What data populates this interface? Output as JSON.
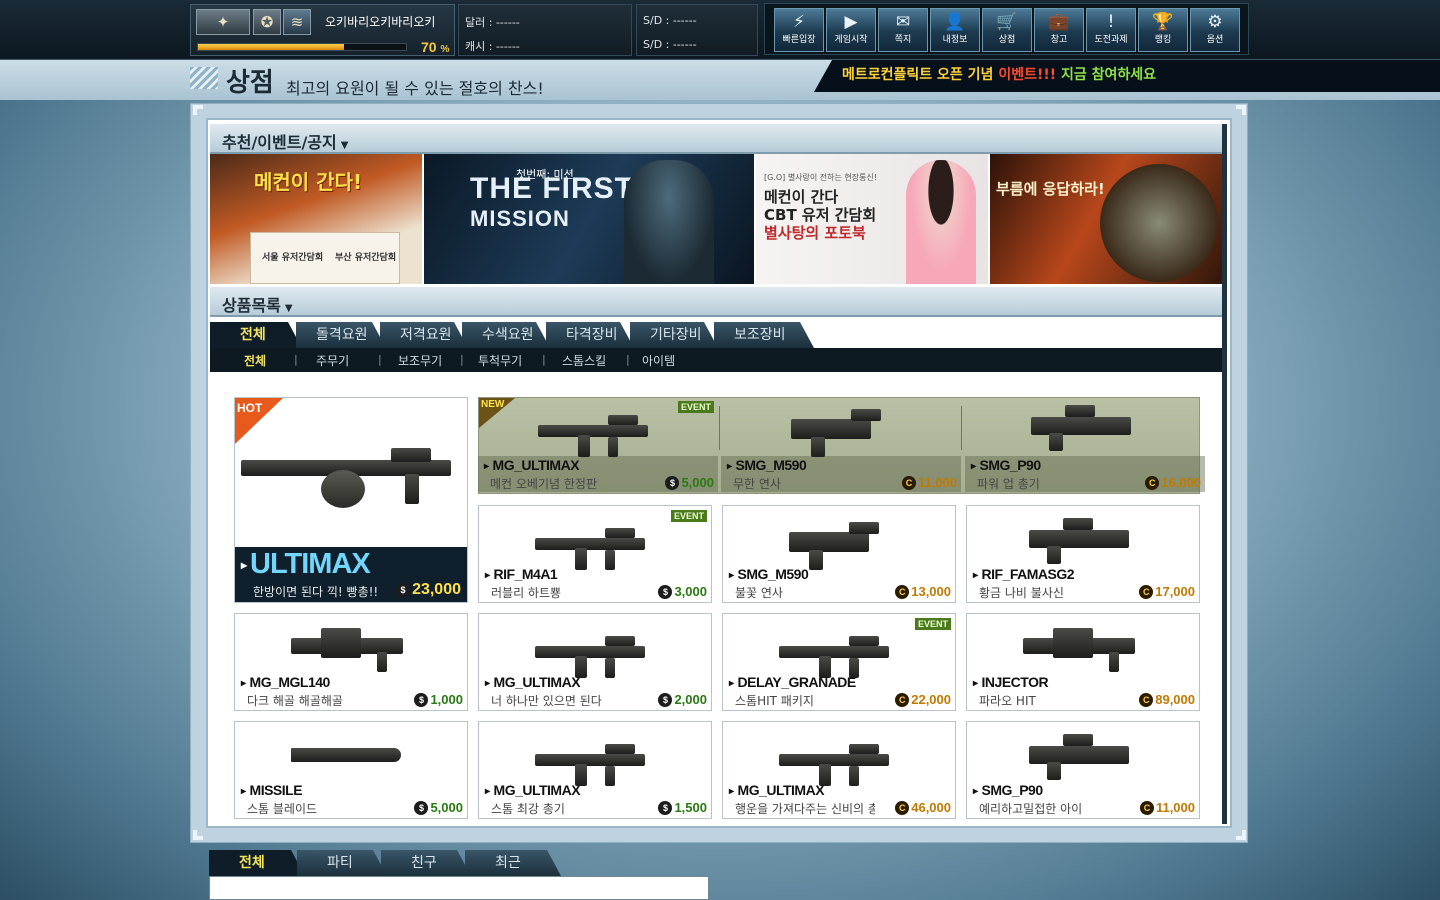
{
  "profile": {
    "nickname": "오키바리오키바리오키",
    "exp_percent": 70,
    "exp_label": "70",
    "exp_unit": "%",
    "rank_icons": [
      "eagle-rank-icon",
      "medal-icon",
      "chevron-rank-icon"
    ]
  },
  "currency": {
    "dollar": "달러 : ------",
    "cash": "캐시 : ------",
    "sd1": "S/D : ------",
    "sd2": "S/D : ------"
  },
  "menu": [
    {
      "label": "빠른입장",
      "icon": "lightning-icon",
      "glyph": "⚡"
    },
    {
      "label": "게임시작",
      "icon": "play-icon",
      "glyph": "▶"
    },
    {
      "label": "쪽지",
      "icon": "mail-icon",
      "glyph": "✉"
    },
    {
      "label": "내정보",
      "icon": "user-icon",
      "glyph": "👤"
    },
    {
      "label": "상점",
      "icon": "cart-icon",
      "glyph": "🛒"
    },
    {
      "label": "창고",
      "icon": "briefcase-icon",
      "glyph": "💼"
    },
    {
      "label": "도전과제",
      "icon": "alert-shield-icon",
      "glyph": "!"
    },
    {
      "label": "랭킹",
      "icon": "trophy-icon",
      "glyph": "🏆"
    },
    {
      "label": "옵션",
      "icon": "gear-icon",
      "glyph": "⚙"
    }
  ],
  "page": {
    "title": "상점",
    "subtitle": "최고의 요원이 될 수 있는 절호의 찬스!"
  },
  "event_banner": {
    "part1": "메트로컨플릭트 오픈 기념",
    "part2": "이벤트!!!",
    "part3": "지금 참여하세요"
  },
  "sections": {
    "recommend": "추천/이벤트/공지",
    "products": "상품목록"
  },
  "banners": {
    "b1": {
      "title": "메컨이 간다!",
      "c1": "서울 유저간담회",
      "c2": "부산 유저간담회"
    },
    "b2": {
      "sub": "첫번째: 미션",
      "line1": "THE FIRST",
      "line2": "MISSION"
    },
    "b3": {
      "small": "[G.O] 별사랑이 전하는 현장통신!",
      "l1": "메컨이 간다",
      "l2": "CBT 유저 간담회",
      "l3": "별사탕의 포토북"
    },
    "b4": {
      "title": "부름에 응답하라!"
    }
  },
  "category_tabs": [
    "전체",
    "돌격요원",
    "저격요원",
    "수색요원",
    "타격장비",
    "기타장비",
    "보조장비"
  ],
  "sub_tabs": [
    "전체",
    "주무기",
    "보조무기",
    "투척무기",
    "스톰스킬",
    "아이템"
  ],
  "hot_item": {
    "badge": "HOT",
    "name": "ULTIMAX",
    "desc": "한방이면 된다 끽! 빵총!!",
    "price": "23,000",
    "currency": "$"
  },
  "featured": [
    {
      "name": "MG_ULTIMAX",
      "desc": "메컨 오베기념 한정판",
      "price": "5,000",
      "currency": "$",
      "new": "NEW",
      "event": "EVENT"
    },
    {
      "name": "SMG_M590",
      "desc": "무한 연사",
      "price": "11,000",
      "currency": "C"
    },
    {
      "name": "SMG_P90",
      "desc": "파워 업 총기",
      "price": "16,000",
      "currency": "C"
    }
  ],
  "products": [
    {
      "name": "RIF_M4A1",
      "desc": "러블리 하트뿅",
      "price": "3,000",
      "currency": "$",
      "event": "EVENT"
    },
    {
      "name": "SMG_M590",
      "desc": "불꽃 연사",
      "price": "13,000",
      "currency": "C"
    },
    {
      "name": "RIF_FAMASG2",
      "desc": "황금 나비 불사신",
      "price": "17,000",
      "currency": "C"
    },
    {
      "name": "MG_MGL140",
      "desc": "다크 해골 해골해골",
      "price": "1,000",
      "currency": "$"
    },
    {
      "name": "MG_ULTIMAX",
      "desc": "너 하나만 있으면 된다",
      "price": "2,000",
      "currency": "$"
    },
    {
      "name": "DELAY_GRANADE",
      "desc": "스톰HIT 패키지",
      "price": "22,000",
      "currency": "C",
      "event": "EVENT"
    },
    {
      "name": "INJECTOR",
      "desc": "파라오 HIT",
      "price": "89,000",
      "currency": "C"
    },
    {
      "name": "MISSILE",
      "desc": "스톰 블레이드",
      "price": "5,000",
      "currency": "$"
    },
    {
      "name": "MG_ULTIMAX",
      "desc": "스톰 최강 총기",
      "price": "1,500",
      "currency": "$"
    },
    {
      "name": "MG_ULTIMAX",
      "desc": "행운을 가져다주는 신비의 총",
      "price": "46,000",
      "currency": "C"
    },
    {
      "name": "SMG_P90",
      "desc": "예리하고밀접한 아이",
      "price": "11,000",
      "currency": "C"
    }
  ],
  "chat_tabs": [
    "전체",
    "파티",
    "친구",
    "최근"
  ],
  "colors": {
    "accent_yellow": "#f2e45a",
    "dollar_price": "#2a7a12",
    "cash_price": "#c07a00",
    "hot_name": "#72d7ff",
    "event_green": "#4b7a1c"
  }
}
